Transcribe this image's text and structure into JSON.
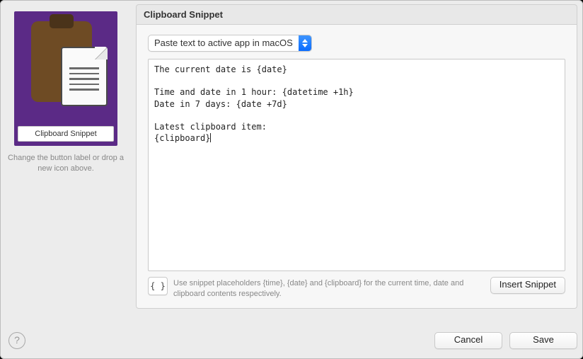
{
  "left": {
    "button_label": "Clipboard Snippet",
    "caption": "Change the button label or drop a new icon above."
  },
  "panel": {
    "title": "Clipboard Snippet",
    "action_select": {
      "selected": "Paste text to active app in macOS"
    },
    "snippet_text": "The current date is {date}\n\nTime and date in 1 hour: {datetime +1h}\nDate in 7 days: {date +7d}\n\nLatest clipboard item:\n{clipboard}",
    "brace_button_label": "{ }",
    "hint_text": "Use snippet placeholders {time}, {date} and {clipboard} for the current time, date and clipboard contents respectively.",
    "insert_button": "Insert Snippet"
  },
  "footer": {
    "help_label": "?",
    "cancel": "Cancel",
    "save": "Save"
  }
}
